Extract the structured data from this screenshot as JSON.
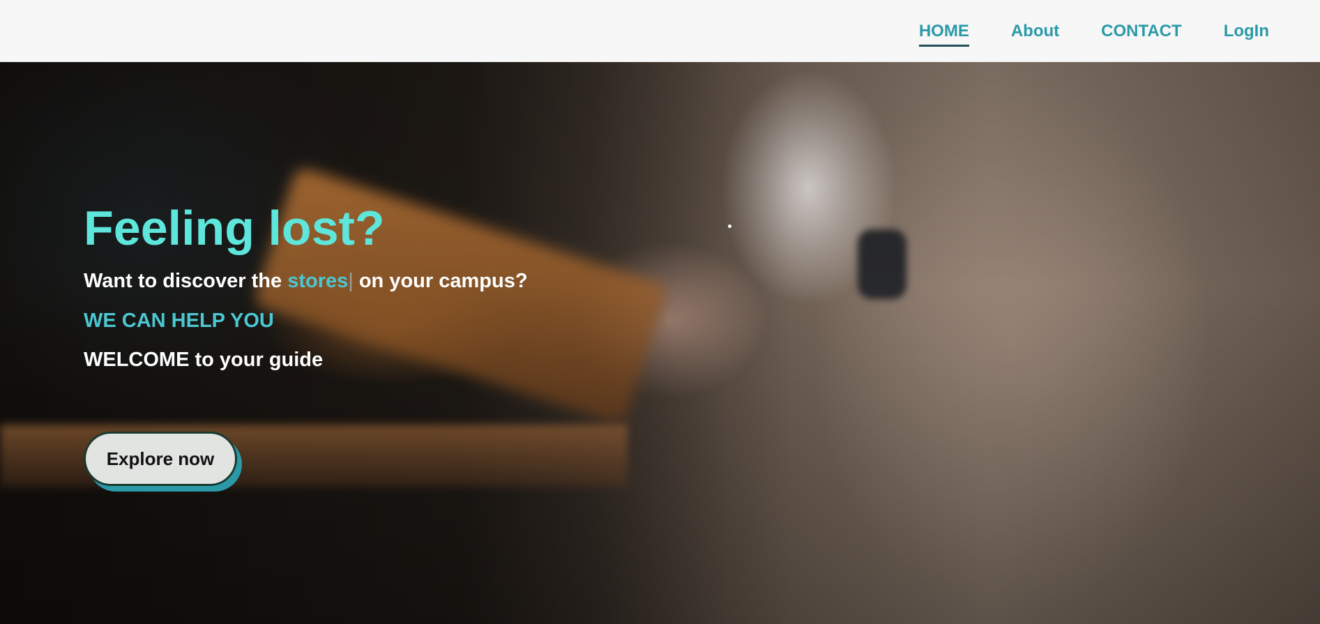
{
  "nav": {
    "items": [
      {
        "label": "HOME",
        "active": true
      },
      {
        "label": "About",
        "active": false
      },
      {
        "label": "CONTACT",
        "active": false
      },
      {
        "label": "LogIn",
        "active": false
      }
    ]
  },
  "hero": {
    "headline": "Feeling lost?",
    "subline_before": "Want to discover the ",
    "subline_typed": "stores",
    "subline_cursor": "|",
    "subline_after": " on your campus?",
    "help_text": "WE CAN HELP YOU",
    "welcome_text": "WELCOME to your guide",
    "cta_label": "Explore now"
  },
  "colors": {
    "accent": "#2a9aa8",
    "headline": "#5ee6dc",
    "highlight": "#4cc7d1",
    "navbar_bg": "#f7f7f7"
  }
}
